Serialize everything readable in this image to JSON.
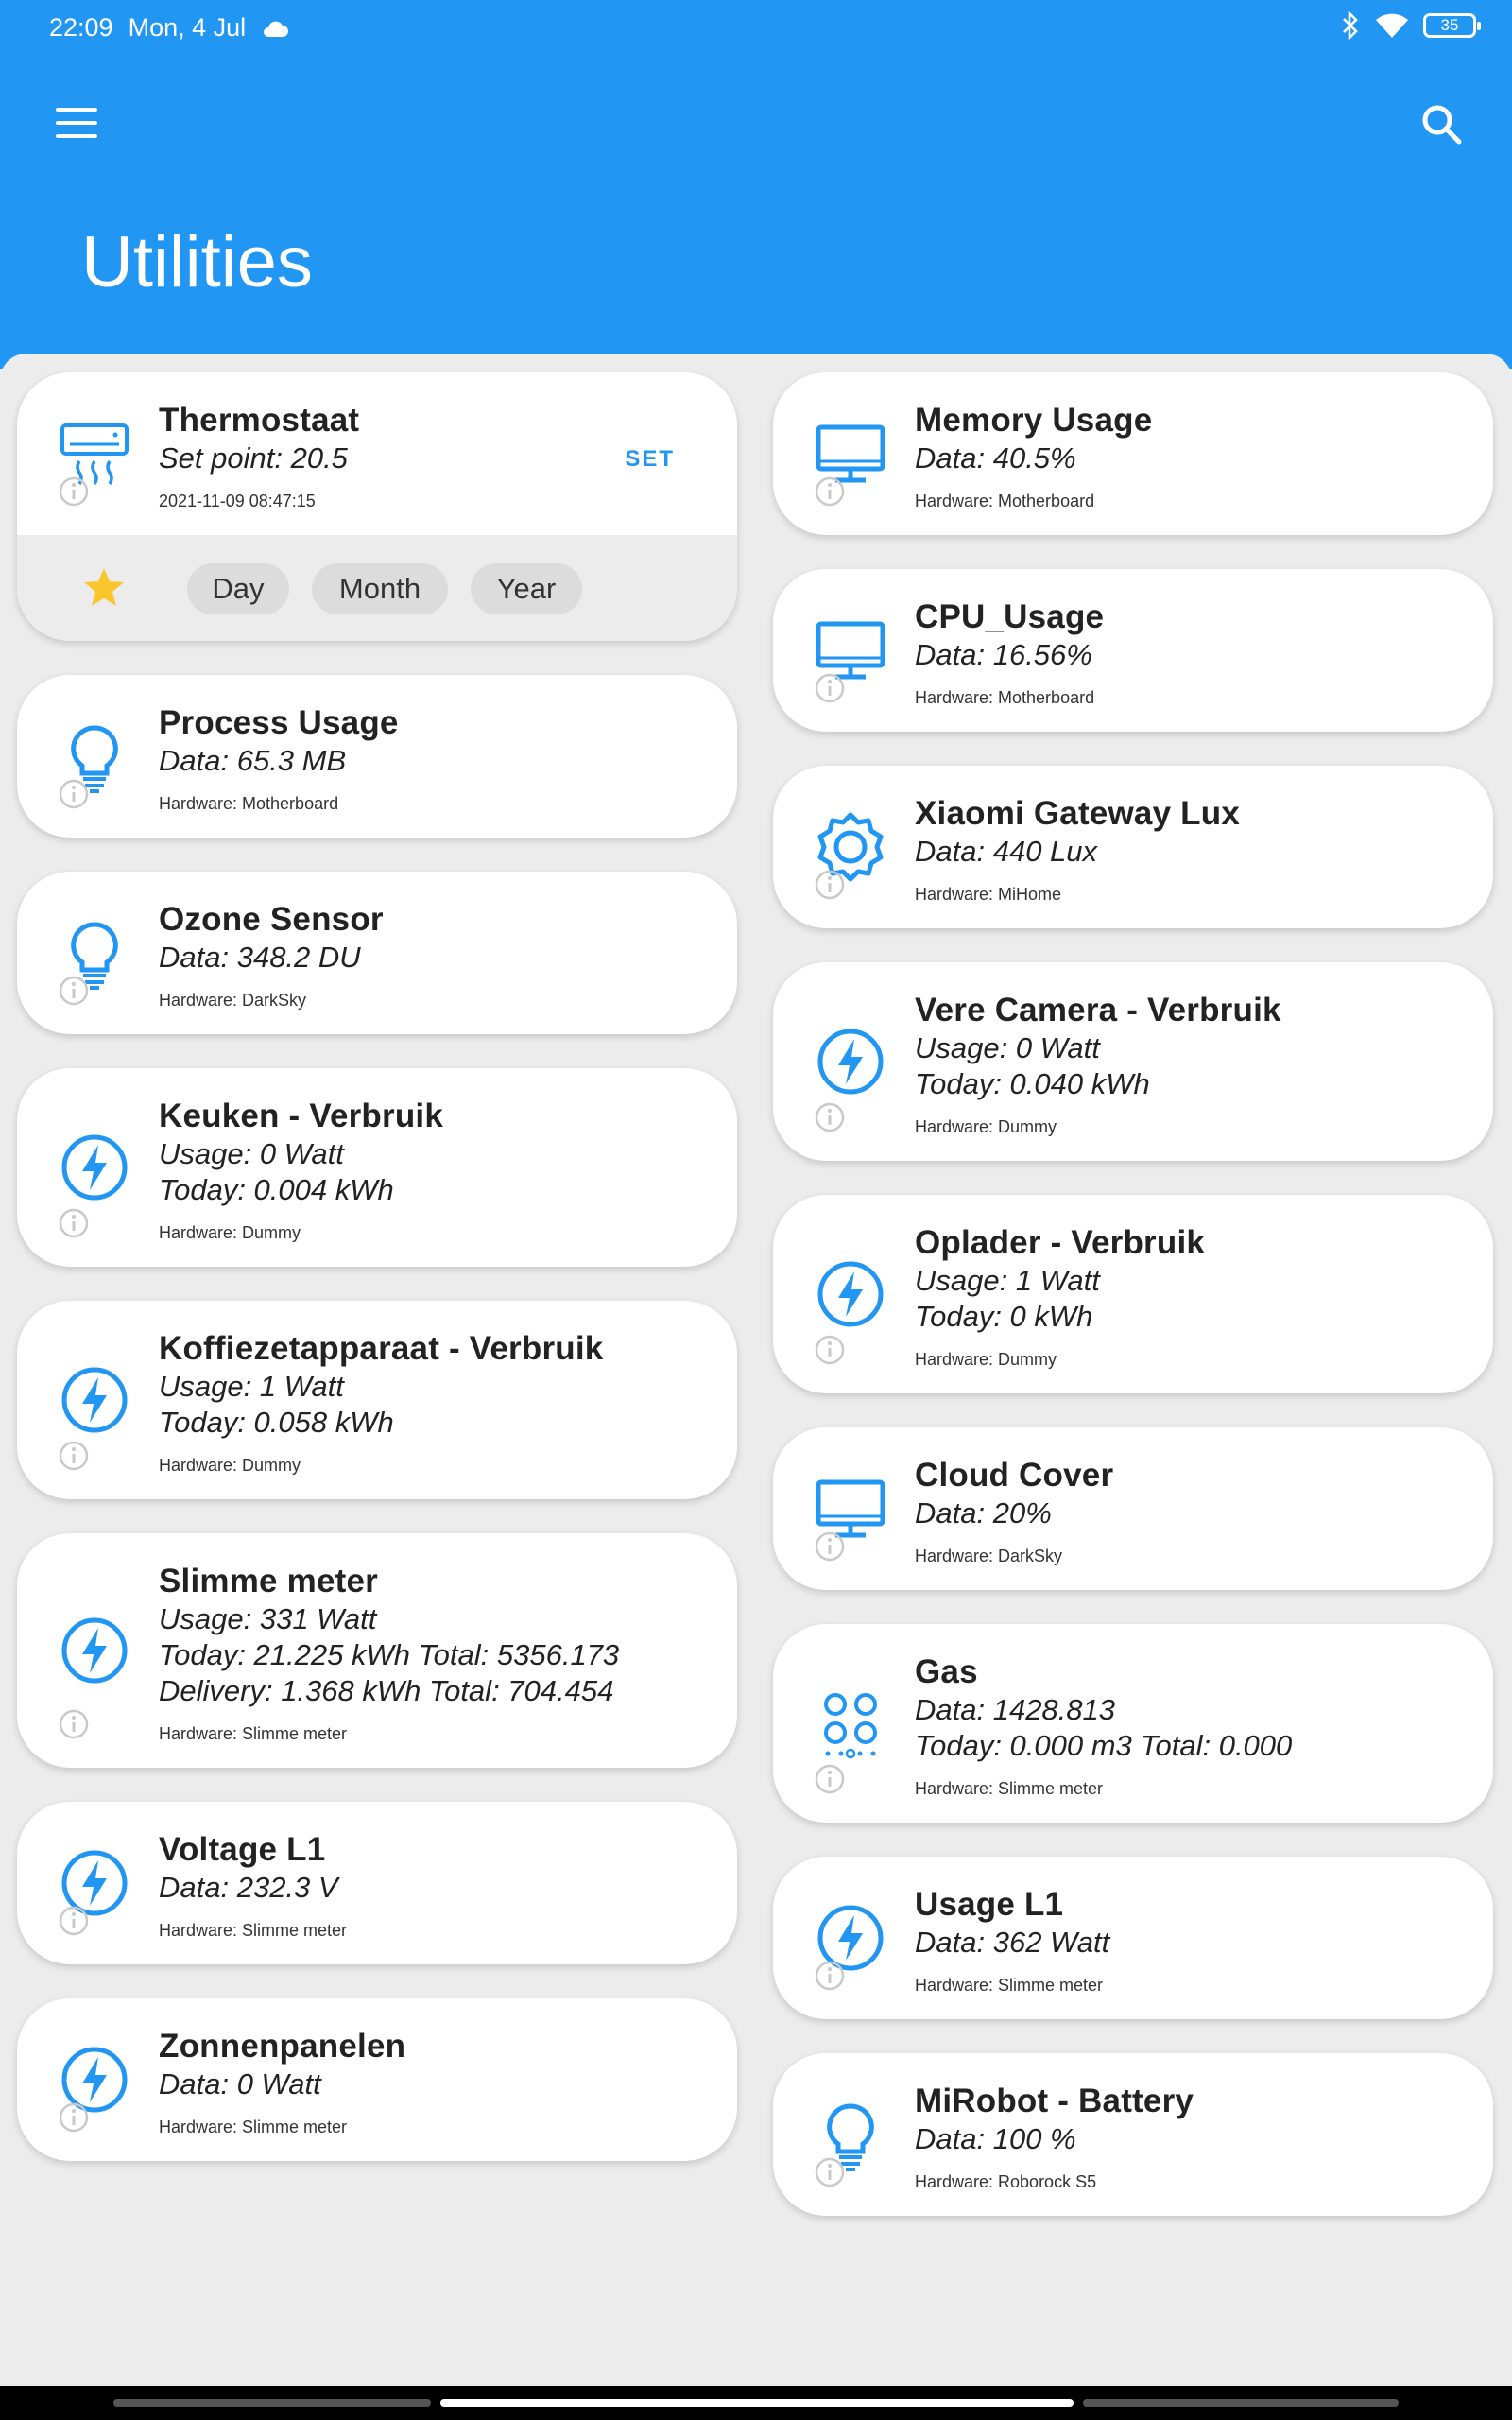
{
  "status_bar": {
    "time": "22:09",
    "date": "Mon, 4 Jul",
    "battery": "35"
  },
  "app_bar": {
    "title": "Utilities"
  },
  "colors": {
    "primary": "#2196f3",
    "star": "#fbc52d",
    "background": "#ececec"
  },
  "thermostat": {
    "name": "Thermostaat",
    "setpoint": "Set point: 20.5",
    "timestamp": "2021-11-09 08:47:15",
    "set_label": "SET",
    "icon": "air-conditioner-icon",
    "ranges": [
      "Day",
      "Month",
      "Year"
    ]
  },
  "left_cards": [
    {
      "name": "Process Usage",
      "lines": [
        "Data: 65.3 MB"
      ],
      "hardware": "Hardware: Motherboard",
      "icon": "bulb-icon"
    },
    {
      "name": "Ozone Sensor",
      "lines": [
        "Data: 348.2 DU"
      ],
      "hardware": "Hardware: DarkSky",
      "icon": "bulb-icon"
    },
    {
      "name": "Keuken - Verbruik",
      "lines": [
        "Usage: 0 Watt",
        "Today: 0.004 kWh"
      ],
      "hardware": "Hardware: Dummy",
      "icon": "lightning-icon"
    },
    {
      "name": "Koffiezetapparaat - Verbruik",
      "lines": [
        "Usage: 1 Watt",
        "Today: 0.058 kWh"
      ],
      "hardware": "Hardware: Dummy",
      "icon": "lightning-icon"
    },
    {
      "name": "Slimme meter",
      "lines": [
        "Usage: 331 Watt",
        "Today: 21.225 kWh Total: 5356.173",
        "Delivery: 1.368 kWh Total: 704.454"
      ],
      "hardware": "Hardware: Slimme meter",
      "icon": "lightning-icon"
    },
    {
      "name": "Voltage L1",
      "lines": [
        "Data: 232.3 V"
      ],
      "hardware": "Hardware: Slimme meter",
      "icon": "lightning-icon"
    },
    {
      "name": "Zonnenpanelen",
      "lines": [
        "Data: 0 Watt"
      ],
      "hardware": "Hardware: Slimme meter",
      "icon": "lightning-icon"
    }
  ],
  "right_cards": [
    {
      "name": "Memory Usage",
      "lines": [
        "Data: 40.5%"
      ],
      "hardware": "Hardware: Motherboard",
      "icon": "monitor-icon"
    },
    {
      "name": "CPU_Usage",
      "lines": [
        "Data: 16.56%"
      ],
      "hardware": "Hardware: Motherboard",
      "icon": "monitor-icon"
    },
    {
      "name": "Xiaomi Gateway Lux",
      "lines": [
        "Data: 440 Lux"
      ],
      "hardware": "Hardware: MiHome",
      "icon": "lux-sensor-icon"
    },
    {
      "name": "Vere Camera - Verbruik",
      "lines": [
        "Usage: 0 Watt",
        "Today: 0.040 kWh"
      ],
      "hardware": "Hardware: Dummy",
      "icon": "lightning-icon"
    },
    {
      "name": "Oplader - Verbruik",
      "lines": [
        "Usage: 1 Watt",
        "Today: 0 kWh"
      ],
      "hardware": "Hardware: Dummy",
      "icon": "lightning-icon"
    },
    {
      "name": "Cloud Cover",
      "lines": [
        "Data: 20%"
      ],
      "hardware": "Hardware: DarkSky",
      "icon": "monitor-icon"
    },
    {
      "name": "Gas",
      "lines": [
        "Data: 1428.813",
        "Today: 0.000 m3 Total: 0.000"
      ],
      "hardware": "Hardware: Slimme meter",
      "icon": "gas-meter-icon"
    },
    {
      "name": "Usage L1",
      "lines": [
        "Data: 362 Watt"
      ],
      "hardware": "Hardware: Slimme meter",
      "icon": "lightning-icon"
    },
    {
      "name": "MiRobot - Battery",
      "lines": [
        "Data: 100 %"
      ],
      "hardware": "Hardware: Roborock S5",
      "icon": "bulb-icon"
    }
  ]
}
